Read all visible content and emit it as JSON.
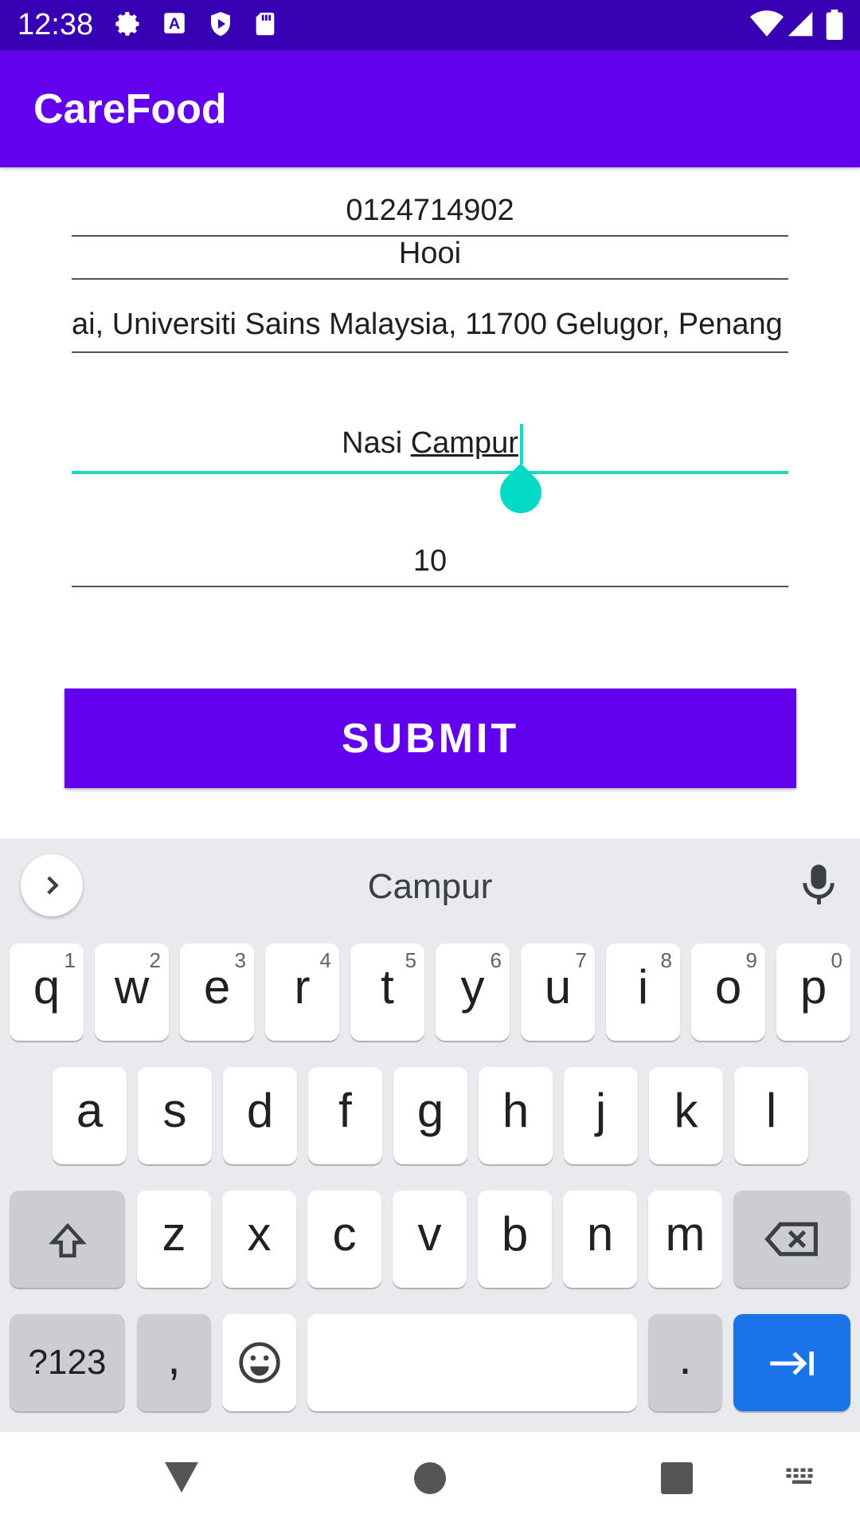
{
  "status_bar": {
    "time": "12:38",
    "icons_left": [
      "settings-icon",
      "a-box-icon",
      "shield-play-icon",
      "sd-card-icon"
    ],
    "icons_right": [
      "wifi-icon",
      "signal-icon",
      "battery-icon"
    ]
  },
  "app_bar": {
    "title": "CareFood"
  },
  "form": {
    "phone_value": "0124714902",
    "name_value": "Hooi",
    "address_value": "ai, Universiti Sains Malaysia, 11700 Gelugor, Penang",
    "food_value_prefix": "Nasi ",
    "food_value_composing": "Campur",
    "quantity_value": "10"
  },
  "submit_button": {
    "label": "SUBMIT"
  },
  "keyboard": {
    "suggestion": "Campur",
    "row1": [
      {
        "ch": "q",
        "hint": "1"
      },
      {
        "ch": "w",
        "hint": "2"
      },
      {
        "ch": "e",
        "hint": "3"
      },
      {
        "ch": "r",
        "hint": "4"
      },
      {
        "ch": "t",
        "hint": "5"
      },
      {
        "ch": "y",
        "hint": "6"
      },
      {
        "ch": "u",
        "hint": "7"
      },
      {
        "ch": "i",
        "hint": "8"
      },
      {
        "ch": "o",
        "hint": "9"
      },
      {
        "ch": "p",
        "hint": "0"
      }
    ],
    "row2": [
      "a",
      "s",
      "d",
      "f",
      "g",
      "h",
      "j",
      "k",
      "l"
    ],
    "row3": [
      "z",
      "x",
      "c",
      "v",
      "b",
      "n",
      "m"
    ],
    "symbols_label": "?123",
    "comma_label": ",",
    "period_label": "."
  },
  "colors": {
    "status_bar": "#3700b3",
    "primary": "#6200ee",
    "accent": "#03dac5",
    "keyboard_bg": "#e8eaed",
    "enter_key": "#1a73e8"
  }
}
